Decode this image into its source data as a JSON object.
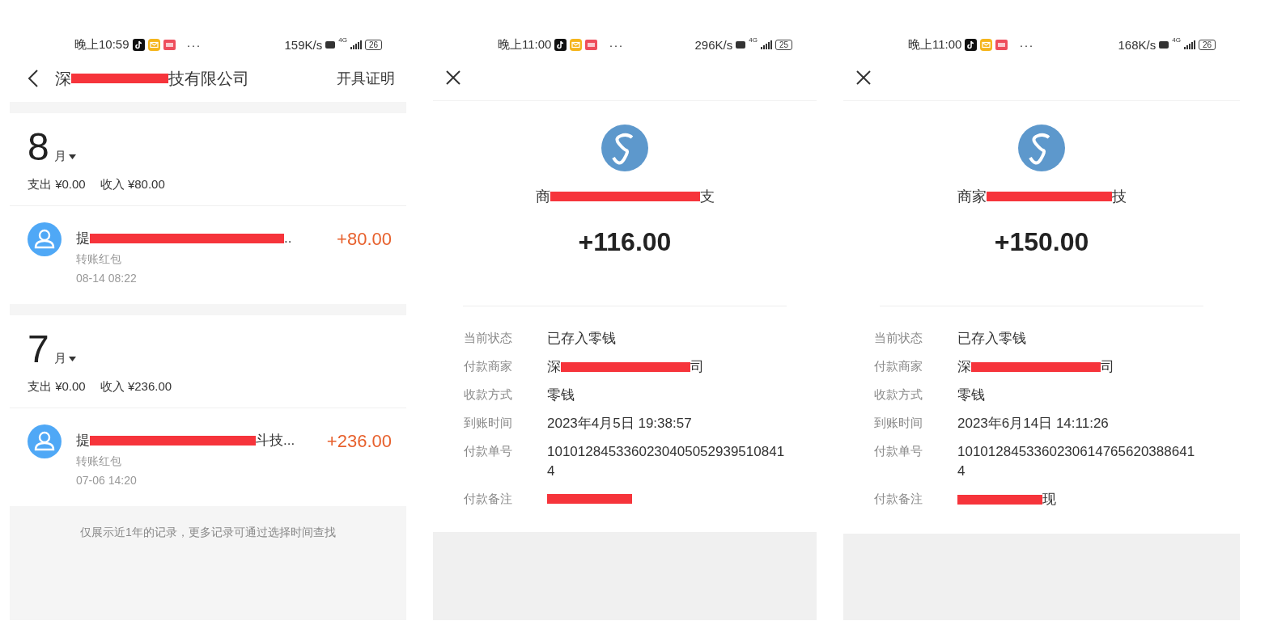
{
  "screens": [
    {
      "kind": "bill_list",
      "status_bar": {
        "time": "晚上10:59",
        "more": "···",
        "speed": "159K/s",
        "network": "4G",
        "battery": "26"
      },
      "nav": {
        "title_start": "深",
        "title_end": "技有限公司",
        "action": "开具证明"
      },
      "months": [
        {
          "month": "8",
          "unit": "月",
          "expense": "支出 ¥0.00",
          "income": "收入 ¥80.00",
          "records": [
            {
              "title_start": "提",
              "title_end": "..",
              "type": "转账红包",
              "time": "08-14  08:22",
              "amount": "+80.00"
            }
          ]
        },
        {
          "month": "7",
          "unit": "月",
          "expense": "支出 ¥0.00",
          "income": "收入 ¥236.00",
          "records": [
            {
              "title_start": "提",
              "title_end": "斗技...",
              "type": "转账红包",
              "time": "07-06  14:20",
              "amount": "+236.00"
            }
          ]
        }
      ],
      "footer": "仅展示近1年的记录，更多记录可通过选择时间查找"
    },
    {
      "kind": "detail",
      "status_bar": {
        "time": "晚上11:00",
        "more": "···",
        "speed": "296K/s",
        "network": "4G",
        "battery": "25"
      },
      "merchant": {
        "start": "商",
        "end": "支"
      },
      "amount": "+116.00",
      "rows": [
        {
          "label": "当前状态",
          "value": "已存入零钱",
          "redacted": false
        },
        {
          "label": "付款商家",
          "value_start": "深",
          "value_end": "司",
          "redacted": true
        },
        {
          "label": "收款方式",
          "value": "零钱",
          "redacted": false
        },
        {
          "label": "到账时间",
          "value": "2023年4月5日 19:38:57",
          "redacted": false
        },
        {
          "label": "付款单号",
          "value": "10101284533602304050529395108414",
          "redacted": false
        },
        {
          "label": "付款备注",
          "redacted": true
        }
      ]
    },
    {
      "kind": "detail",
      "status_bar": {
        "time": "晚上11:00",
        "more": "···",
        "speed": "168K/s",
        "network": "4G",
        "battery": "26"
      },
      "merchant": {
        "start": "商家",
        "end": "技"
      },
      "amount": "+150.00",
      "rows": [
        {
          "label": "当前状态",
          "value": "已存入零钱",
          "redacted": false
        },
        {
          "label": "付款商家",
          "value_start": "深",
          "value_end": "司",
          "redacted": true
        },
        {
          "label": "收款方式",
          "value": "零钱",
          "redacted": false
        },
        {
          "label": "到账时间",
          "value": "2023年6月14日 14:11:26",
          "redacted": false
        },
        {
          "label": "付款单号",
          "value": "10101284533602306147656203886414",
          "redacted": false
        },
        {
          "label": "付款备注",
          "value_end": "现",
          "redacted": true
        }
      ]
    }
  ]
}
